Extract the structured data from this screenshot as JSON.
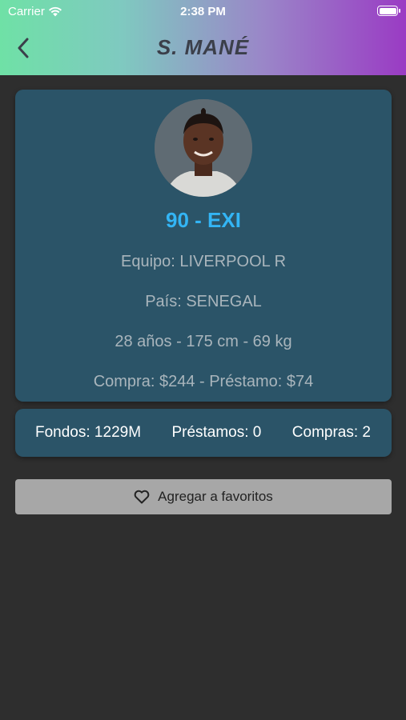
{
  "status_bar": {
    "carrier": "Carrier",
    "time": "2:38 PM"
  },
  "nav": {
    "title": "S. MANÉ"
  },
  "player": {
    "rating": "90 - EXI",
    "team": "Equipo: LIVERPOOL R",
    "country": "País: SENEGAL",
    "physical": "28 años - 175 cm - 69 kg",
    "price": "Compra: $244 - Préstamo:  $74"
  },
  "stats": {
    "funds": "Fondos: 1229M",
    "loans": "Préstamos: 0",
    "purchases": "Compras: 2"
  },
  "actions": {
    "favorite_label": "Agregar a favoritos"
  },
  "icons": {
    "back": "chevron-left-icon",
    "favorite": "heart-outline-icon",
    "wifi": "wifi-icon",
    "battery": "battery-icon"
  },
  "colors": {
    "card": "#2b5468",
    "rating": "#33b5f5",
    "background": "#2e2e2e"
  }
}
